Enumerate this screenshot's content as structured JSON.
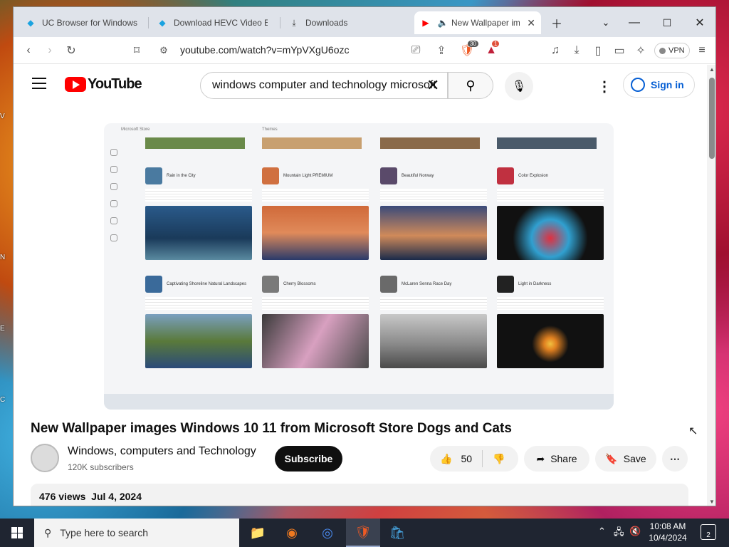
{
  "desktop": {
    "labels": [
      "V",
      "N",
      "E",
      "C"
    ]
  },
  "browser": {
    "tabs": [
      {
        "title": "UC Browser for Windows",
        "icon": "uc-browser-icon"
      },
      {
        "title": "Download HEVC Video Ex",
        "icon": "uc-browser-icon"
      },
      {
        "title": "Downloads",
        "icon": "download-icon"
      },
      {
        "title": "New Wallpaper ima",
        "icon": "youtube-icon",
        "active": true
      }
    ],
    "url": "youtube.com/watch?v=mYpVXgU6ozc",
    "brave_shield_count": "30",
    "rewards_count": "1",
    "vpn_label": "VPN"
  },
  "youtube": {
    "logo_text": "YouTube",
    "search_value": "windows computer and technology microsoft",
    "signin_label": "Sign in",
    "video": {
      "title": "New Wallpaper images Windows 10 11 from Microsoft Store Dogs and Cats",
      "channel_name": "Windows, computers and Technology",
      "subscribers": "120K subscribers",
      "subscribe_label": "Subscribe",
      "likes": "50",
      "share_label": "Share",
      "save_label": "Save",
      "views": "476 views",
      "date": "Jul 4, 2024"
    },
    "store_frame": {
      "app_title": "Microsoft Store",
      "section": "Themes",
      "cards": [
        {
          "name": "Rain in the City"
        },
        {
          "name": "Mountain Light PREMIUM"
        },
        {
          "name": "Beautiful Norway"
        },
        {
          "name": "Color Explosion"
        },
        {
          "name": "Captivating Shoreline Natural Landscapes"
        },
        {
          "name": "Cherry Blossoms"
        },
        {
          "name": "McLaren Senna Race Day"
        },
        {
          "name": "Light in Darkness"
        }
      ]
    }
  },
  "taskbar": {
    "search_placeholder": "Type here to search",
    "time": "10:08 AM",
    "date": "10/4/2024",
    "notification_count": "2"
  }
}
